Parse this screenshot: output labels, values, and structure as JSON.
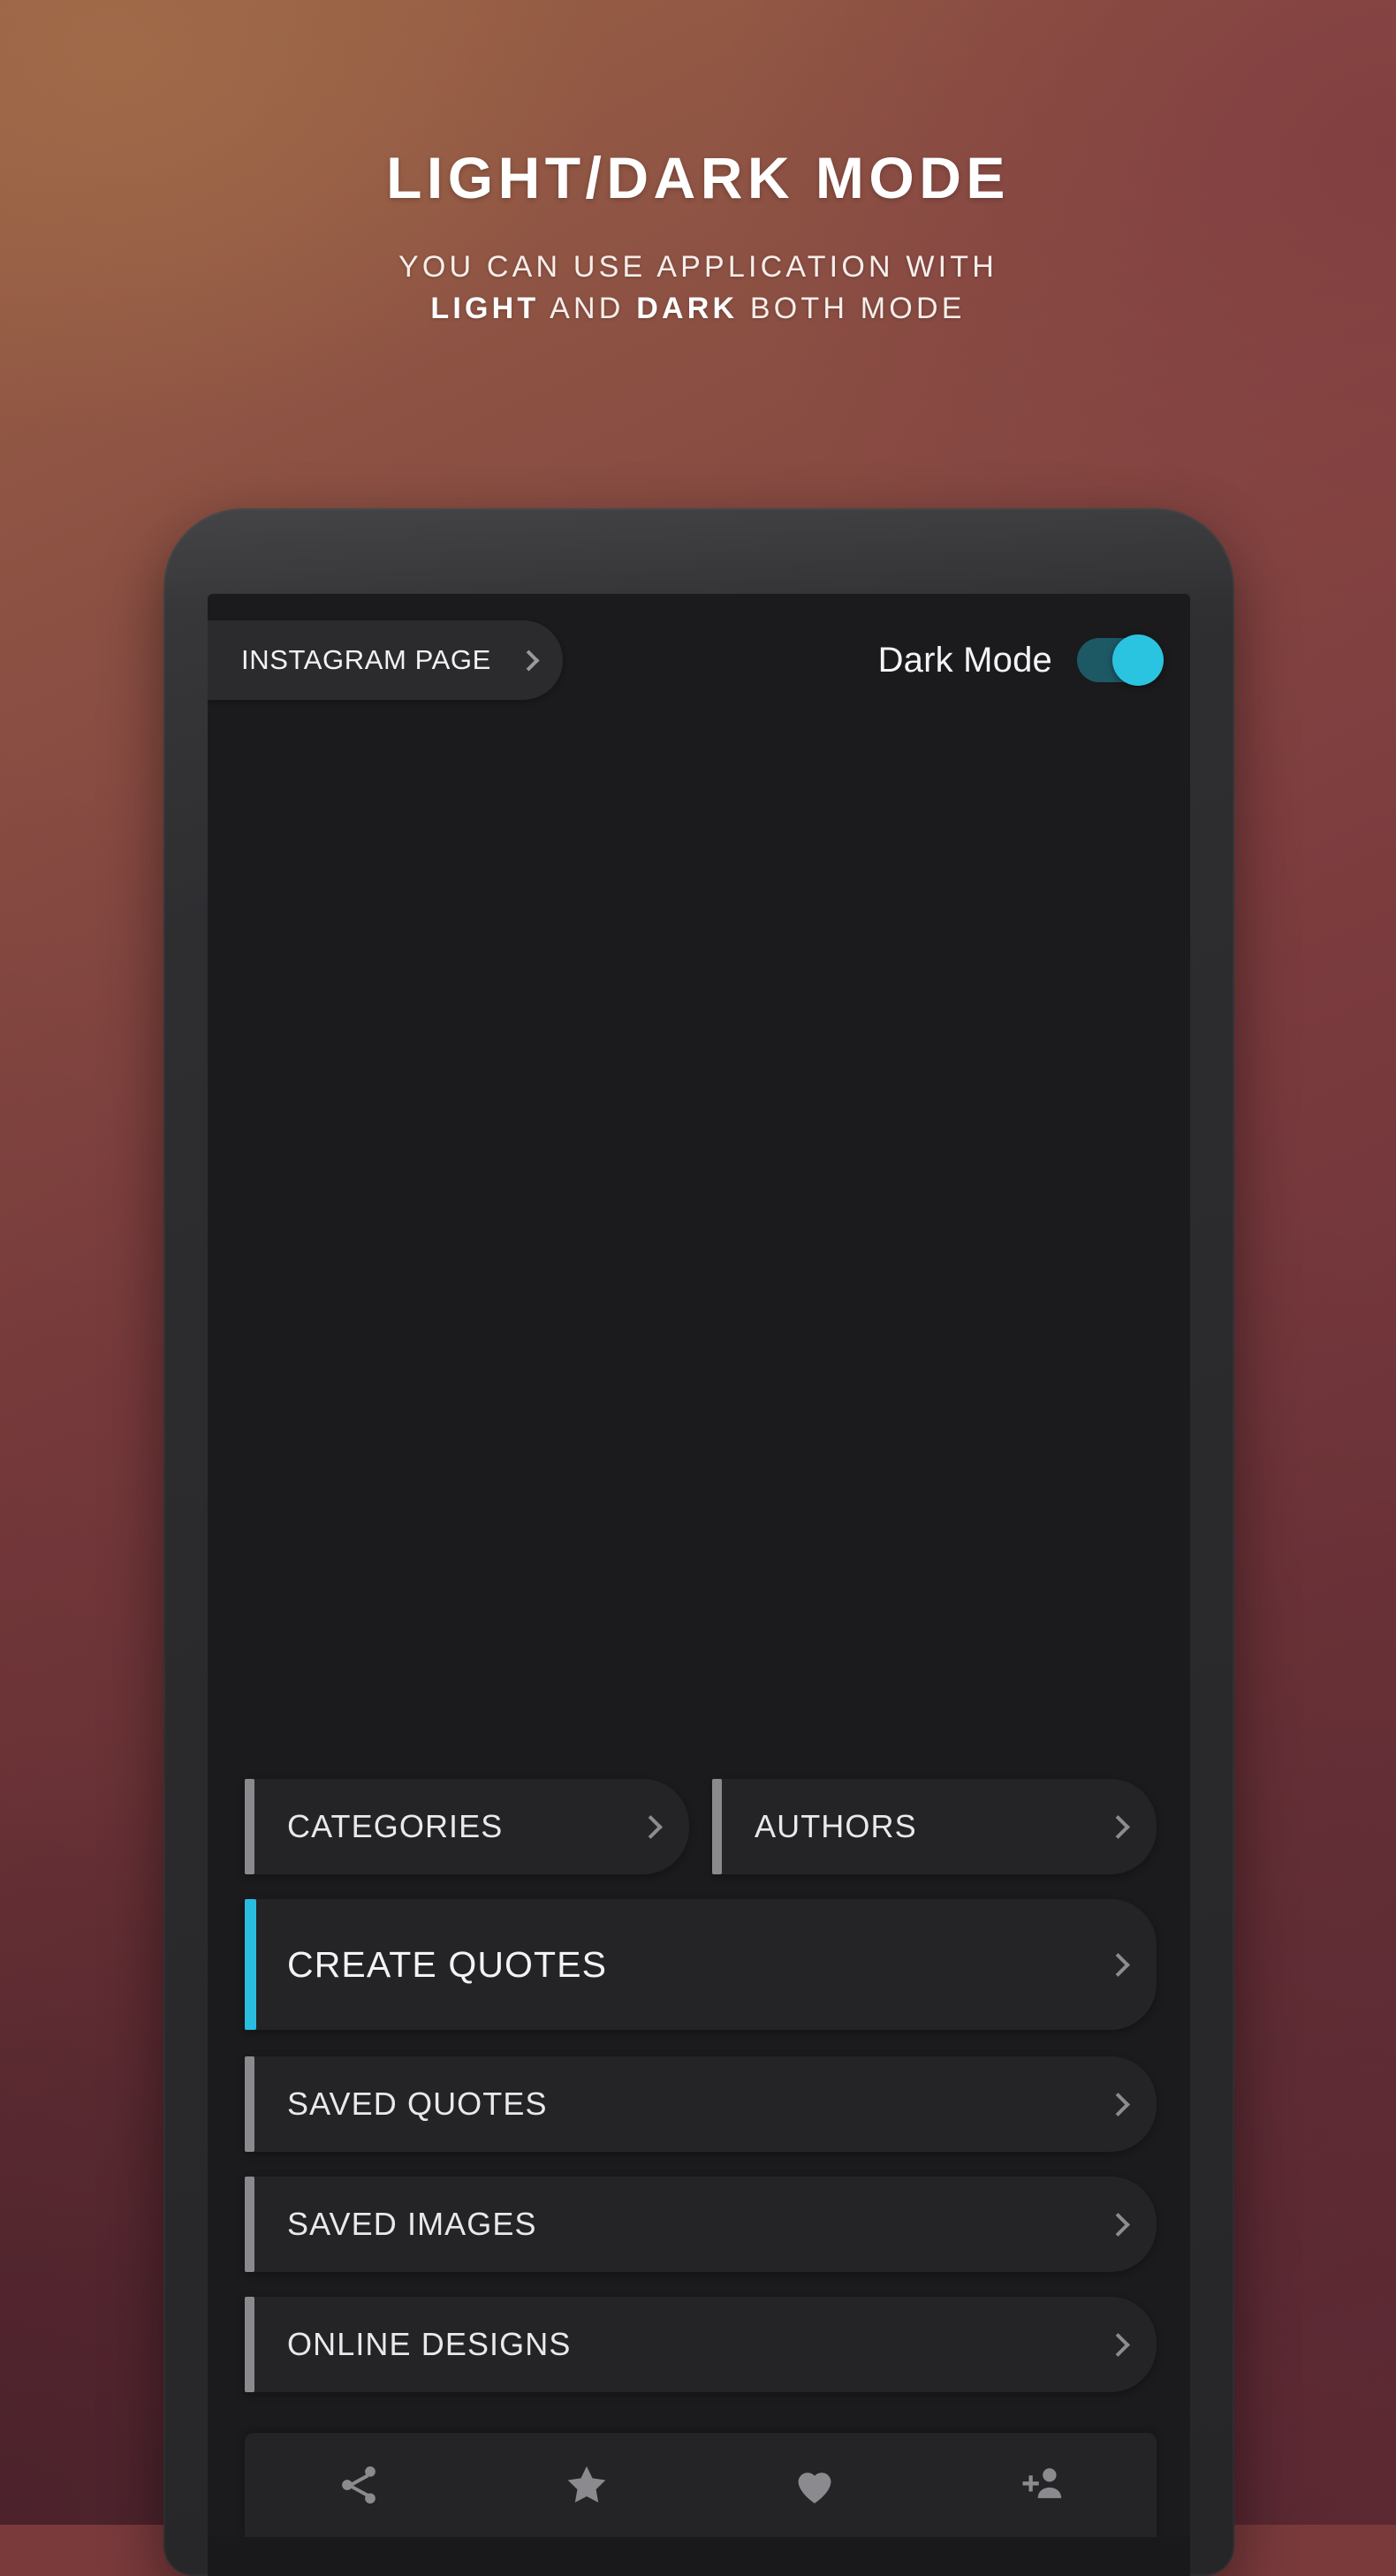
{
  "header": {
    "title": "LIGHT/DARK MODE",
    "subtitle_line1": "YOU CAN USE  APPLICATION WITH",
    "subtitle_line2_a": "LIGHT",
    "subtitle_line2_b": " AND ",
    "subtitle_line2_c": "DARK",
    "subtitle_line2_d": " BOTH MODE"
  },
  "topbar": {
    "instagram_label": "INSTAGRAM PAGE",
    "dark_mode_label": "Dark Mode",
    "dark_mode_on": true
  },
  "menu": {
    "row_top": [
      {
        "label": "CATEGORIES",
        "accent": "#8a8a8e",
        "active": false
      },
      {
        "label": "AUTHORS",
        "accent": "#8a8a8e",
        "active": false
      }
    ],
    "items": [
      {
        "label": "CREATE QUOTES",
        "accent": "#29bde0",
        "active": true
      },
      {
        "label": "SAVED QUOTES",
        "accent": "#8a8a8e",
        "active": false
      },
      {
        "label": "SAVED IMAGES",
        "accent": "#8a8a8e",
        "active": false
      },
      {
        "label": "ONLINE DESIGNS",
        "accent": "#8a8a8e",
        "active": false
      }
    ]
  },
  "bottom_nav": [
    {
      "icon": "share-icon"
    },
    {
      "icon": "star-icon"
    },
    {
      "icon": "heart-icon"
    },
    {
      "icon": "add-person-icon"
    }
  ],
  "colors": {
    "accent_cyan": "#29bde0",
    "toggle_track": "#1d5965",
    "toggle_knob": "#2bc4e0",
    "screen_bg": "#1b1a1d",
    "card_bg": "#242426",
    "bezel": "#2e2e31",
    "bg_top_left": "#9a6245",
    "bg_top_right": "#7e3d3f",
    "bg_bottom": "#5e2b37"
  }
}
